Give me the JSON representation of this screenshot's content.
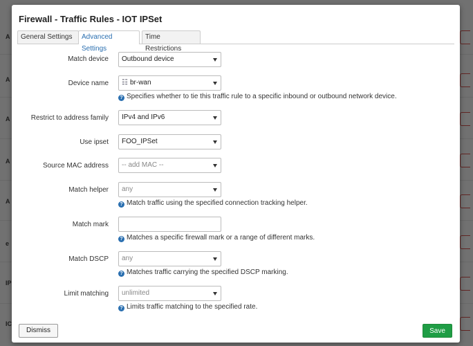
{
  "modal": {
    "title": "Firewall - Traffic Rules - IOT IPSet",
    "tabs": [
      {
        "label": "General Settings",
        "active": false
      },
      {
        "label": "Advanced Settings",
        "active": true
      },
      {
        "label": "Time Restrictions",
        "active": false
      }
    ],
    "fields": {
      "match_device": {
        "label": "Match device",
        "value": "Outbound device"
      },
      "device_name": {
        "label": "Device name",
        "value": "br-wan",
        "icon": "network-device-icon",
        "help": "Specifies whether to tie this traffic rule to a specific inbound or outbound network device."
      },
      "address_family": {
        "label": "Restrict to address family",
        "value": "IPv4 and IPv6"
      },
      "use_ipset": {
        "label": "Use ipset",
        "value": "FOO_IPSet"
      },
      "source_mac": {
        "label": "Source MAC address",
        "value": "-- add MAC --"
      },
      "match_helper": {
        "label": "Match helper",
        "value": "any",
        "help": "Match traffic using the specified connection tracking helper."
      },
      "match_mark": {
        "label": "Match mark",
        "value": "",
        "help": "Matches a specific firewall mark or a range of different marks."
      },
      "match_dscp": {
        "label": "Match DSCP",
        "value": "any",
        "help": "Matches traffic carrying the specified DSCP marking."
      },
      "limit_matching": {
        "label": "Limit matching",
        "value": "unlimited",
        "help": "Limits traffic matching to the specified rate."
      }
    },
    "buttons": {
      "dismiss": "Dismiss",
      "save": "Save"
    }
  },
  "background": {
    "row_letters": [
      "A",
      "A",
      "A",
      "A",
      "A",
      "e",
      "IP",
      "IC"
    ]
  },
  "colors": {
    "accent": "#2a6fb0",
    "save": "#1f9d45"
  }
}
